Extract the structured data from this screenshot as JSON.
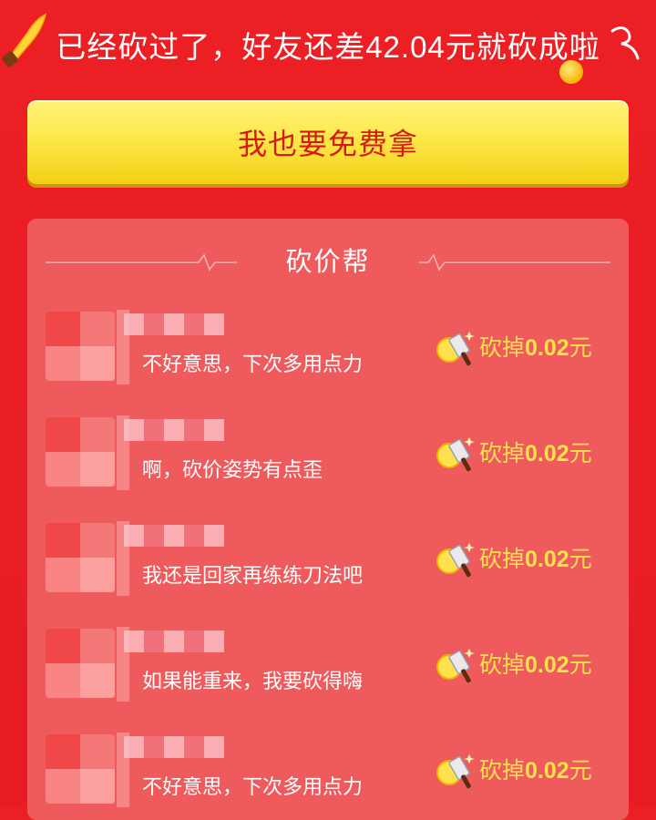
{
  "header": {
    "message": "已经砍过了，好友还差42.04元就砍成啦"
  },
  "claim_button": {
    "label": "我也要免费拿"
  },
  "helpers_panel": {
    "title": "砍价帮",
    "items": [
      {
        "message": "不好意思，下次多用点力",
        "cut_prefix": "砍掉",
        "cut_amount": "0.02",
        "cut_unit": "元"
      },
      {
        "message": "啊，砍价姿势有点歪",
        "cut_prefix": "砍掉",
        "cut_amount": "0.02",
        "cut_unit": "元"
      },
      {
        "message": "我还是回家再练练刀法吧",
        "cut_prefix": "砍掉",
        "cut_amount": "0.02",
        "cut_unit": "元"
      },
      {
        "message": "如果能重来，我要砍得嗨",
        "cut_prefix": "砍掉",
        "cut_amount": "0.02",
        "cut_unit": "元"
      },
      {
        "message": "不好意思，下次多用点力",
        "cut_prefix": "砍掉",
        "cut_amount": "0.02",
        "cut_unit": "元"
      }
    ]
  },
  "colors": {
    "background": "#e91e24",
    "panel": "#ef5a5c",
    "button_yellow": "#fde84a",
    "button_text": "#d41a13",
    "cut_text": "#ffe14d"
  },
  "icons": [
    "knife-icon",
    "swirl-icon",
    "coin-icon",
    "heartbeat-line-icon",
    "cleaver-coin-icon"
  ]
}
